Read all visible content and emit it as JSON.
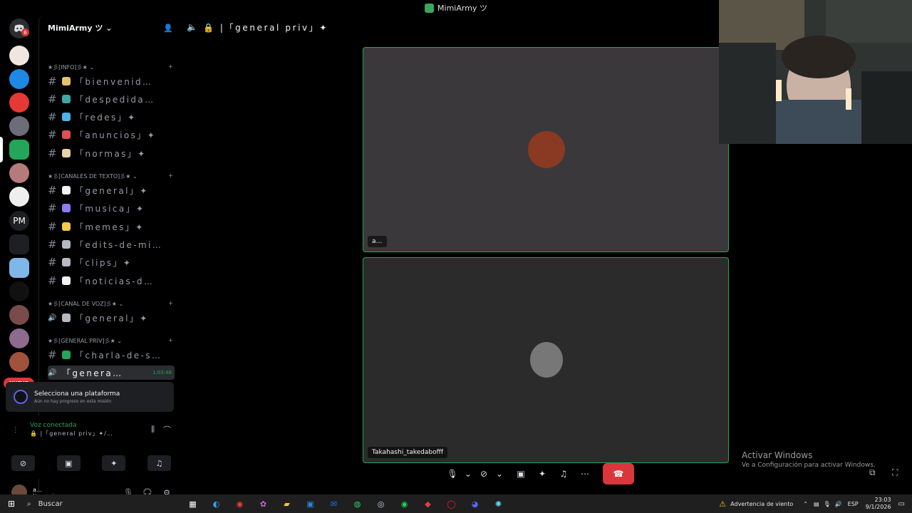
{
  "window": {
    "title": "MimiArmy ツ"
  },
  "rail": {
    "badge": "6",
    "pm_label": "PM",
    "nuevo_label": "NUEVO",
    "server_colors": [
      "#5865f2",
      "#f0e6e0",
      "#1e88e5",
      "#e53935",
      "#6d6d7a",
      "#23a55a",
      "#b57b7b",
      "#eeeeee",
      "#1e1f22",
      "#7fb8e8",
      "#111111",
      "#7a4b4b",
      "#8c6b8f",
      "#a0523d",
      "#2b5fa8"
    ]
  },
  "sidebar": {
    "guild_name": "MimiArmy ツ",
    "categories": [
      {
        "label": "★彡[INFO]彡★ ⌄"
      },
      {
        "label": "★彡[CANALES DE TEXTO]彡★ ⌄"
      },
      {
        "label": "★彡[CANAL DE VOZ]彡★ ⌄"
      },
      {
        "label": "★彡[GENERAL PRIV]彡★ ⌄"
      }
    ],
    "channels": [
      {
        "icon": "#",
        "emoji_color": "#e8c16a",
        "name": "「bienvenid…"
      },
      {
        "icon": "#",
        "emoji_color": "#3fa7a7",
        "name": "「despedida…"
      },
      {
        "icon": "#",
        "emoji_color": "#4fb3e8",
        "name": "「redes」✦"
      },
      {
        "icon": "#",
        "emoji_color": "#e05151",
        "name": "「anuncios」✦"
      },
      {
        "icon": "#",
        "emoji_color": "#e8d3a9",
        "name": "「normas」✦"
      },
      {
        "icon": "#",
        "emoji_color": "#f2f3f5",
        "name": "「general」✦"
      },
      {
        "icon": "#",
        "emoji_color": "#8b7cf2",
        "name": "「musica」✦"
      },
      {
        "icon": "#",
        "emoji_color": "#f4c84a",
        "name": "「memes」✦"
      },
      {
        "icon": "#",
        "emoji_color": "#b5bac1",
        "name": "「edits-de-mi…"
      },
      {
        "icon": "#",
        "emoji_color": "#b5bac1",
        "name": "「clips」✦"
      },
      {
        "icon": "#",
        "emoji_color": "#f2f3f5",
        "name": "「noticias-d…"
      },
      {
        "icon": "🔊",
        "emoji_color": "#b5bac1",
        "name": "「general」✦"
      },
      {
        "icon": "#",
        "emoji_color": "#23a55a",
        "name": "「charla-de-s…"
      }
    ],
    "active_channel": {
      "icon": "🔊",
      "name": "「genera…",
      "time": "1:03:48"
    },
    "mission": {
      "title": "Selecciona una plataforma",
      "subtitle": "Aún no hay progreso en esta misión"
    },
    "voice": {
      "status": "Voz conectada",
      "channel": "🔒 |「general priv」✦/…"
    },
    "user": {
      "name": "a…",
      "status": "Never give up"
    }
  },
  "header": {
    "channel": "🔒 |「general priv」✦"
  },
  "tiles": [
    {
      "label": "a…",
      "avatar_color": "#8a3a22"
    },
    {
      "label": "Takahashi_takedabofff",
      "avatar_color": "#777777"
    }
  ],
  "watermark": {
    "title": "Activar Windows",
    "subtitle": "Ve a Configuración para activar Windows."
  },
  "taskbar": {
    "search_placeholder": "Buscar",
    "weather": "Advertencia de viento",
    "lang": "ESP",
    "time": "23:03",
    "date": "9/1/2026"
  }
}
